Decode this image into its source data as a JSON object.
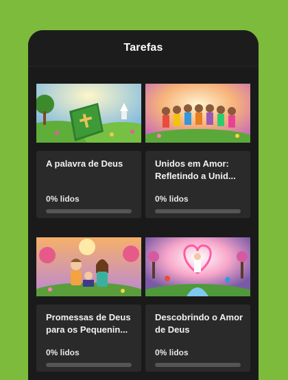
{
  "header": {
    "title": "Tarefas"
  },
  "tasks": [
    {
      "title": "A palavra de Deus",
      "progress_text": "0% lidos",
      "progress": 0
    },
    {
      "title": "Unidos em Amor: Refletindo a Unid...",
      "progress_text": "0% lidos",
      "progress": 0
    },
    {
      "title": "Promessas de Deus para os Pequenin...",
      "progress_text": "0% lidos",
      "progress": 0
    },
    {
      "title": "Descobrindo o Amor de Deus",
      "progress_text": "0% lidos",
      "progress": 0
    }
  ],
  "colors": {
    "background": "#7dbb3c",
    "panel": "#1a1a1a",
    "card": "#2a2a2a",
    "track": "#555555"
  }
}
